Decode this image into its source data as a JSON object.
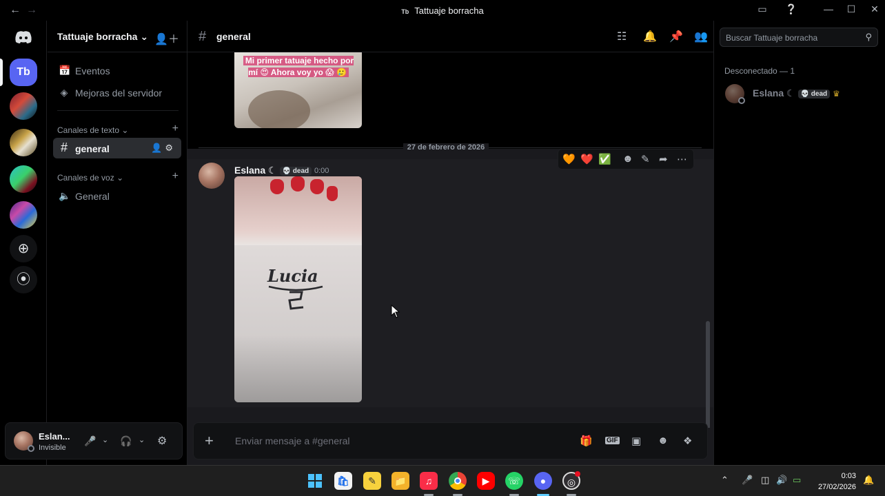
{
  "window": {
    "title": "Tattuaje borracha",
    "title_badge": "Tb",
    "back_icon": "arrow-left-icon",
    "forward_icon": "arrow-right-icon"
  },
  "server_rail": {
    "active_server_label": "Tb"
  },
  "sidebar": {
    "server_name": "Tattuaje borracha",
    "items": [
      {
        "label": "Eventos",
        "icon": "calendar-icon"
      },
      {
        "label": "Mejoras del servidor",
        "icon": "boost-icon"
      }
    ],
    "text_category": "Canales de texto",
    "text_channels": [
      {
        "label": "general",
        "active": true
      }
    ],
    "voice_category": "Canales de voz",
    "voice_channels": [
      {
        "label": "General"
      }
    ]
  },
  "user_panel": {
    "name": "Eslan...",
    "status": "Invisible"
  },
  "channel_header": {
    "name": "general"
  },
  "messages": {
    "first_image_caption": "Mi primer tatuaje hecho por mí 😍 Ahora voy yo 😱 🥲",
    "date_divider": "27 de febrero de 2026",
    "author": "Eslana ☾",
    "author_tag": "💀 dead",
    "time": "0:00",
    "tattoo_text": "Lucia"
  },
  "composer": {
    "placeholder": "Enviar mensaje a #general"
  },
  "members": {
    "search_placeholder": "Buscar Tattuaje borracha",
    "group_label": "Desconectado — 1",
    "member_name": "Eslana ☾",
    "member_tag": "💀 dead"
  },
  "taskbar": {
    "time": "0:03",
    "date": "27/02/2026"
  },
  "colors": {
    "accent": "#5865f2",
    "background": "#000000",
    "chat_bg": "#1a1a1e"
  }
}
